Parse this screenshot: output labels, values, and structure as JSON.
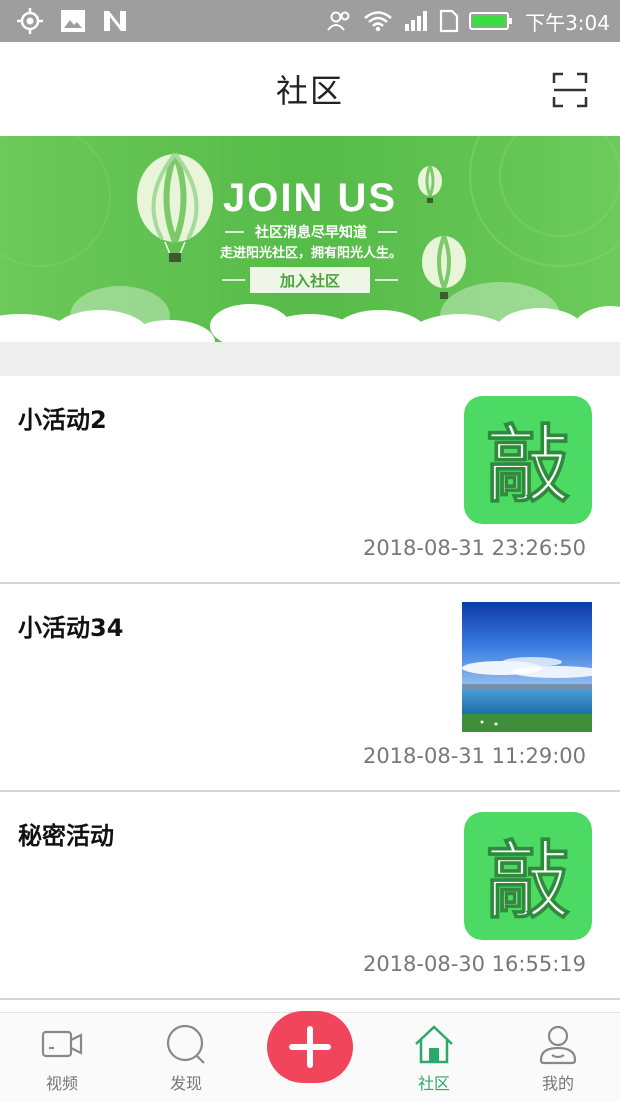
{
  "statusbar": {
    "time": "下午3:04"
  },
  "header": {
    "title": "社区"
  },
  "banner": {
    "headline": "JOIN US",
    "line1": "社区消息尽早知道",
    "line2": "走进阳光社区，拥有阳光人生。",
    "button": "加入社区"
  },
  "items": [
    {
      "title": "小活动2",
      "time": "2018-08-31 23:26:50",
      "thumb_glyph": "敲"
    },
    {
      "title": "小活动34",
      "time": "2018-08-31 11:29:00"
    },
    {
      "title": "秘密活动",
      "time": "2018-08-30 16:55:19",
      "thumb_glyph": "敲"
    }
  ],
  "nav": {
    "video": "视频",
    "discover": "发现",
    "community": "社区",
    "mine": "我的"
  },
  "colors": {
    "accent": "#2ea86a",
    "add": "#f0455a",
    "banner": "#5bbf4c",
    "icon_green": "#4cd964"
  }
}
